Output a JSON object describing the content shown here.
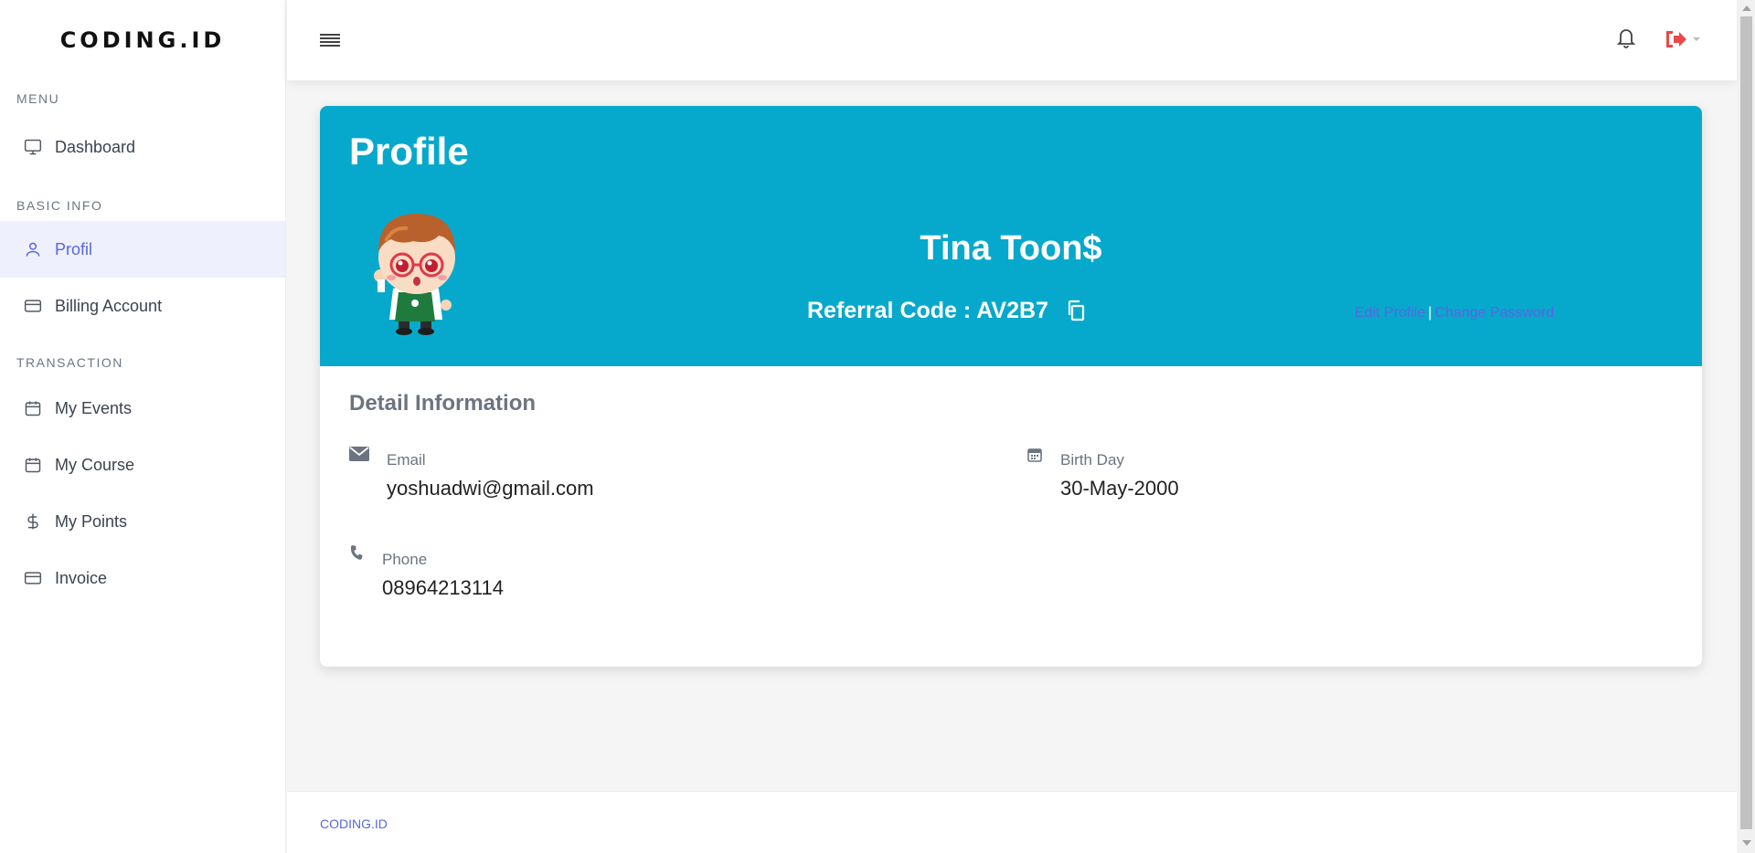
{
  "brand": "CODING.ID",
  "sidebar": {
    "sections": [
      {
        "label": "MENU",
        "items": [
          {
            "label": "Dashboard",
            "icon": "monitor-icon"
          }
        ]
      },
      {
        "label": "BASIC INFO",
        "items": [
          {
            "label": "Profil",
            "icon": "user-icon",
            "active": true
          },
          {
            "label": "Billing Account",
            "icon": "credit-card-icon"
          }
        ]
      },
      {
        "label": "TRANSACTION",
        "items": [
          {
            "label": "My Events",
            "icon": "calendar-icon"
          },
          {
            "label": "My Course",
            "icon": "calendar-icon"
          },
          {
            "label": "My Points",
            "icon": "dollar-icon"
          },
          {
            "label": "Invoice",
            "icon": "credit-card-icon"
          }
        ]
      }
    ]
  },
  "topbar": {
    "menu_icon": "hamburger-icon",
    "notification_icon": "bell-icon",
    "logout_icon": "sign-out-icon"
  },
  "profile": {
    "title": "Profile",
    "name": "Tina Toon$",
    "referral_label": "Referral Code : AV2B7",
    "edit_profile": "Edit Profile",
    "separator": "|",
    "change_password": "Change Password"
  },
  "details": {
    "title": "Detail Information",
    "email_label": "Email",
    "email_value": "yoshuadwi@gmail.com",
    "birthday_label": "Birth Day",
    "birthday_value": "30-May-2000",
    "phone_label": "Phone",
    "phone_value": "08964213114"
  },
  "footer": "CODING.ID",
  "colors": {
    "accent": "#5a66e0",
    "header_bg": "#06a9cc",
    "logout": "#e84a4a"
  }
}
